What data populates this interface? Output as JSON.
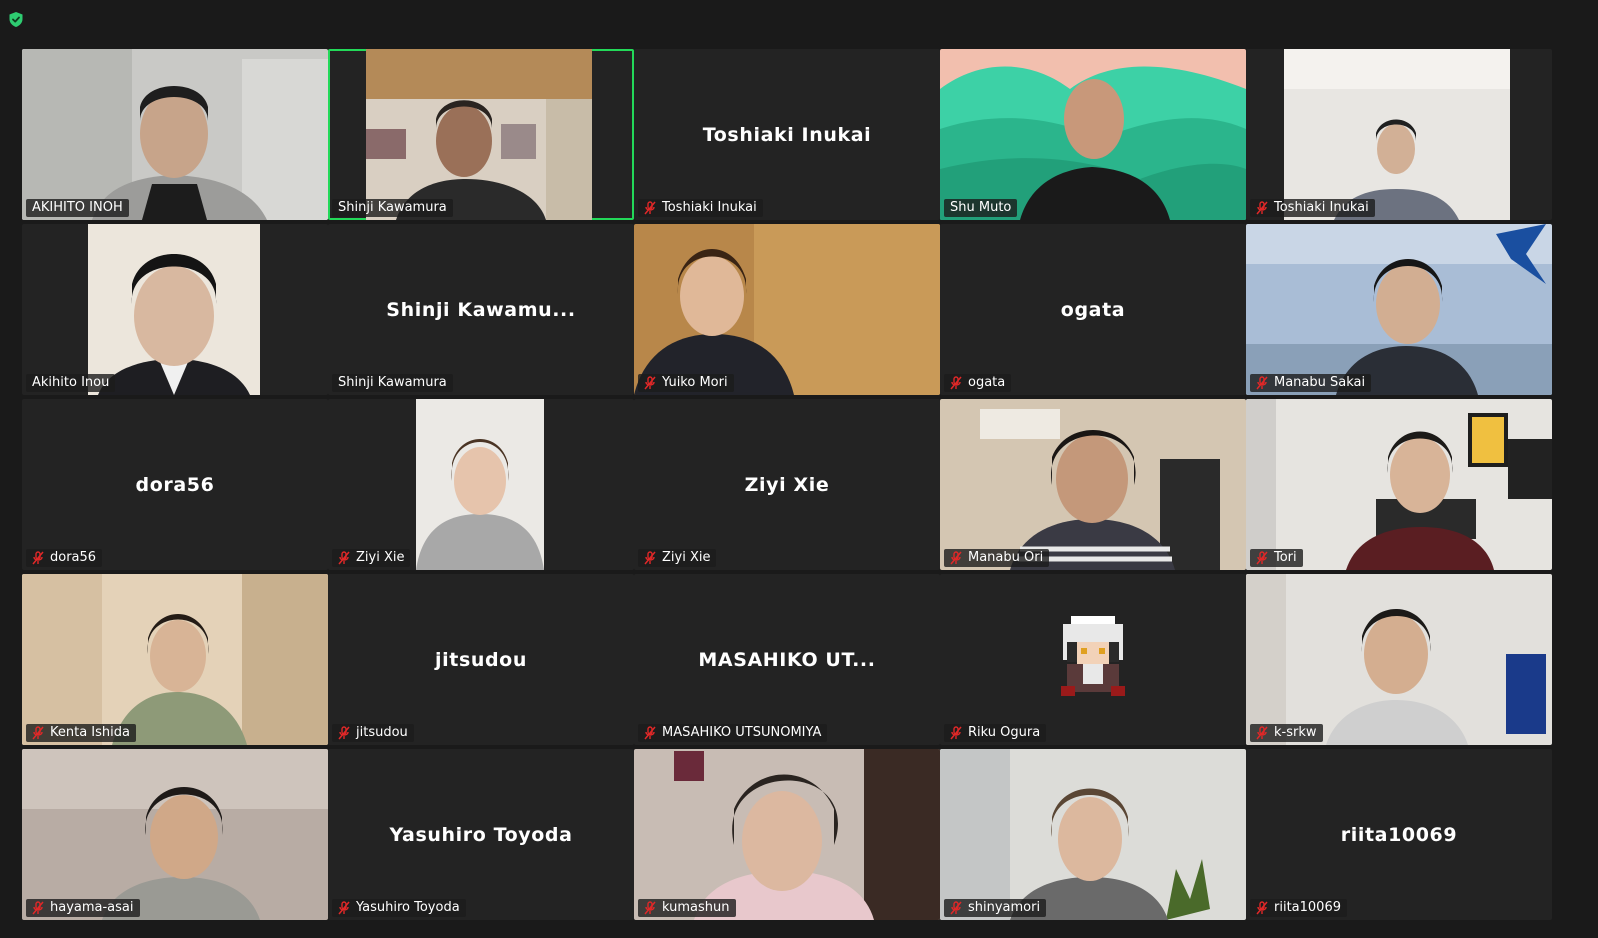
{
  "colors": {
    "background": "#1a1a1a",
    "tile": "#232323",
    "active_speaker_border": "#23d959",
    "muted_red": "#e02828",
    "shield": "#2ecc71"
  },
  "topbar": {
    "security_icon": "shield-check-icon"
  },
  "participants": [
    {
      "tag": "AKIHITO INOH",
      "muted": false,
      "video": true
    },
    {
      "tag": "Shinji Kawamura",
      "muted": false,
      "video": true,
      "active_speaker": true
    },
    {
      "tag": "Toshiaki Inukai",
      "muted": true,
      "video": false,
      "display_name": "Toshiaki Inukai"
    },
    {
      "tag": "Shu Muto",
      "muted": false,
      "video": true
    },
    {
      "tag": "Toshiaki Inukai",
      "muted": true,
      "video": true
    },
    {
      "tag": "Akihito Inou",
      "muted": false,
      "video": true
    },
    {
      "tag": "Shinji Kawamura",
      "muted": false,
      "video": false,
      "display_name": "Shinji Kawamu..."
    },
    {
      "tag": "Yuiko Mori",
      "muted": true,
      "video": true
    },
    {
      "tag": "ogata",
      "muted": true,
      "video": false,
      "display_name": "ogata"
    },
    {
      "tag": "Manabu Sakai",
      "muted": true,
      "video": true
    },
    {
      "tag": "dora56",
      "muted": true,
      "video": false,
      "display_name": "dora56"
    },
    {
      "tag": "Ziyi Xie",
      "muted": true,
      "video": true
    },
    {
      "tag": "Ziyi Xie",
      "muted": true,
      "video": false,
      "display_name": "Ziyi Xie"
    },
    {
      "tag": "Manabu Ori",
      "muted": true,
      "video": true
    },
    {
      "tag": "Tori",
      "muted": true,
      "video": true
    },
    {
      "tag": "Kenta Ishida",
      "muted": true,
      "video": true
    },
    {
      "tag": "jitsudou",
      "muted": true,
      "video": false,
      "display_name": "jitsudou"
    },
    {
      "tag": "MASAHIKO UTSUNOMIYA",
      "muted": true,
      "video": false,
      "display_name": "MASAHIKO UT..."
    },
    {
      "tag": "Riku Ogura",
      "muted": true,
      "video": true,
      "avatar": "pixel-art-character"
    },
    {
      "tag": "k-srkw",
      "muted": true,
      "video": true
    },
    {
      "tag": "hayama-asai",
      "muted": true,
      "video": true
    },
    {
      "tag": "Yasuhiro Toyoda",
      "muted": true,
      "video": false,
      "display_name": "Yasuhiro Toyoda"
    },
    {
      "tag": "kumashun",
      "muted": true,
      "video": true
    },
    {
      "tag": "shinyamori",
      "muted": true,
      "video": true
    },
    {
      "tag": "riita10069",
      "muted": true,
      "video": false,
      "display_name": "riita10069"
    }
  ]
}
